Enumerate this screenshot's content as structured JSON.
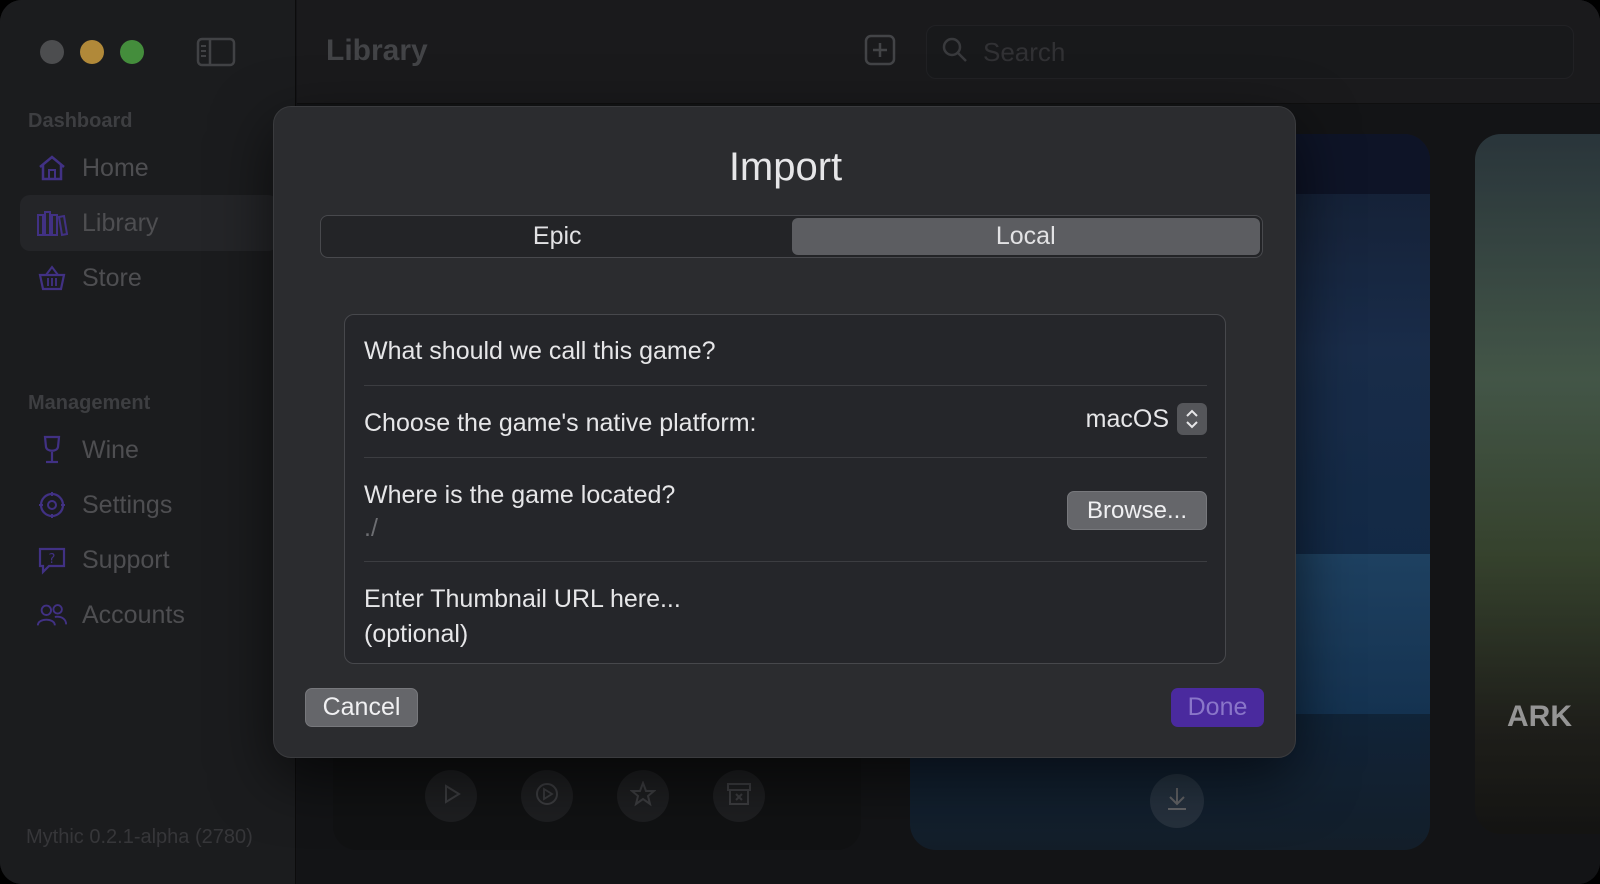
{
  "window": {
    "traffic_lights": [
      "close",
      "minimize",
      "zoom"
    ]
  },
  "sidebar": {
    "toggle_icon": "sidebar-toggle-icon",
    "sections": [
      {
        "label": "Dashboard",
        "items": [
          {
            "label": "Home",
            "icon": "house-icon",
            "active": false
          },
          {
            "label": "Library",
            "icon": "books-icon",
            "active": true
          },
          {
            "label": "Store",
            "icon": "basket-icon",
            "active": false
          }
        ]
      },
      {
        "label": "Management",
        "items": [
          {
            "label": "Wine",
            "icon": "wineglass-icon",
            "active": false
          },
          {
            "label": "Settings",
            "icon": "gear-icon",
            "active": false
          },
          {
            "label": "Support",
            "icon": "question-bubble-icon",
            "active": false
          },
          {
            "label": "Accounts",
            "icon": "people-icon",
            "active": false
          }
        ]
      }
    ],
    "version": "Mythic 0.2.1-alpha (2780)"
  },
  "toolbar": {
    "title": "Library",
    "add_icon": "plus-square-icon",
    "search_placeholder": "Search"
  },
  "background": {
    "card_c_label": "ARK",
    "colors": {
      "accent": "#6b4fd8"
    }
  },
  "dialog": {
    "title": "Import",
    "tabs": [
      {
        "label": "Epic",
        "selected": false
      },
      {
        "label": "Local",
        "selected": true
      }
    ],
    "form": {
      "name_placeholder": "What should we call this game?",
      "platform_label": "Choose the game's native platform:",
      "platform_value": "macOS",
      "location_label": "Where is the game located?",
      "location_value": "./",
      "browse_label": "Browse...",
      "thumbnail_placeholder_line1": "Enter Thumbnail URL here...",
      "thumbnail_placeholder_line2": "(optional)"
    },
    "cancel_label": "Cancel",
    "done_label": "Done"
  }
}
